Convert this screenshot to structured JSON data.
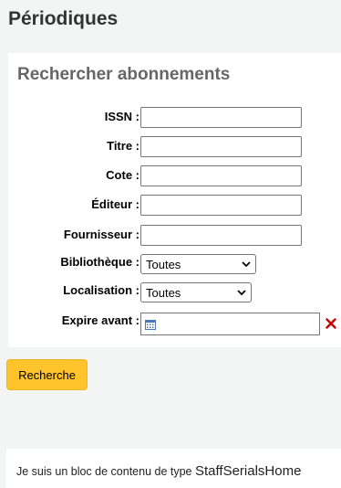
{
  "page": {
    "title": "Périodiques"
  },
  "search_panel": {
    "title": "Rechercher abonnements",
    "fields": {
      "issn": {
        "label": "ISSN :",
        "value": ""
      },
      "titre": {
        "label": "Titre :",
        "value": ""
      },
      "cote": {
        "label": "Cote :",
        "value": ""
      },
      "editeur": {
        "label": "Éditeur :",
        "value": ""
      },
      "fournisseur": {
        "label": "Fournisseur :",
        "value": ""
      },
      "bibliotheque": {
        "label": "Bibliothèque :",
        "selected": "Toutes"
      },
      "localisation": {
        "label": "Localisation :",
        "selected": "Toutes"
      },
      "expire_avant": {
        "label": "Expire avant :",
        "value": ""
      }
    },
    "search_button": "Recherche"
  },
  "content_block": {
    "text": "Je suis un bloc de contenu de type",
    "type_name": "StaffSerialsHome"
  },
  "colors": {
    "accent_button": "#ffc32b",
    "clear_icon": "#cc0000",
    "panel_title": "#666666"
  },
  "icons": [
    "calendar-icon",
    "clear-date-icon",
    "chevron-down-icon"
  ]
}
